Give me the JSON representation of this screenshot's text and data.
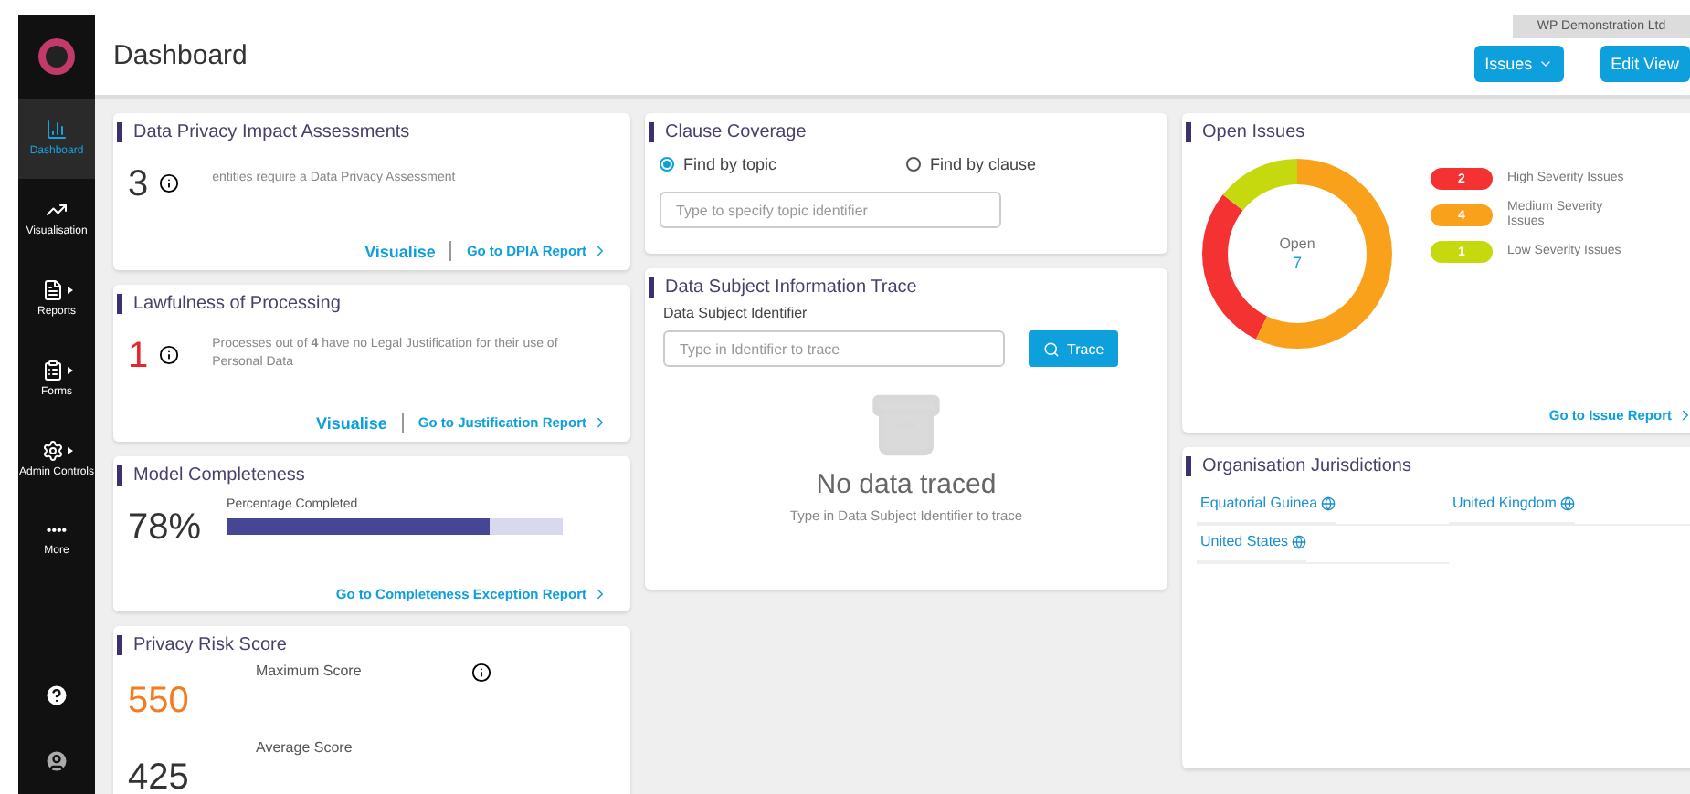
{
  "sidebar": {
    "items": [
      {
        "label": "Dashboard",
        "selected": true,
        "submenu": false
      },
      {
        "label": "Visualisation",
        "selected": false,
        "submenu": false
      },
      {
        "label": "Reports",
        "selected": false,
        "submenu": true
      },
      {
        "label": "Forms",
        "selected": false,
        "submenu": true
      },
      {
        "label": "Admin Controls",
        "selected": false,
        "submenu": true
      },
      {
        "label": "More",
        "selected": false,
        "submenu": false,
        "glyph": "••••"
      }
    ]
  },
  "header": {
    "title": "Dashboard",
    "organisation": "WP Demonstration Ltd",
    "buttons": [
      {
        "label": "Issues",
        "dropdown": true
      },
      {
        "label": "Edit View",
        "dropdown": false
      }
    ]
  },
  "dpia": {
    "title": "Data Privacy Impact Assessments",
    "count": "3",
    "text": "entities require a Data Privacy Assessment",
    "links": [
      "Visualise",
      "Go to DPIA Report"
    ]
  },
  "lawfulness": {
    "title": "Lawfulness of Processing",
    "count": "1",
    "text": "Processes out of **4** have no Legal Justification for their use of Personal Data",
    "links": [
      "Visualise",
      "Go to Justification Report"
    ]
  },
  "model_completeness": {
    "title": "Model Completeness",
    "percent": "78%",
    "bar_label": "Percentage Completed",
    "level": 0.78,
    "link": "Go to Completeness Exception Report"
  },
  "privacy_risk": {
    "title": "Privacy Risk Score",
    "scores": [
      {
        "value": "550",
        "label": "Maximum Score",
        "color": "#f47b20"
      },
      {
        "value": "425",
        "label": "Average Score",
        "color": "#333333"
      }
    ]
  },
  "clause_coverage": {
    "title": "Clause Coverage",
    "options": [
      {
        "label": "Find by topic",
        "selected": true
      },
      {
        "label": "Find by clause",
        "selected": false
      }
    ],
    "placeholder": "Type to specify topic identifier"
  },
  "trace": {
    "title": "Data Subject Information Trace",
    "field_label": "Data Subject Identifier",
    "placeholder": "Type in Identifier to trace",
    "button": "Trace",
    "empty_title": "No data traced",
    "empty_text": "Type in Data Subject Identifier to trace"
  },
  "open_issues": {
    "title": "Open Issues",
    "center_label": "Open",
    "center_value": "7",
    "legend": [
      {
        "count": "2",
        "label": "High Severity Issues",
        "color": "#f53232"
      },
      {
        "count": "4",
        "label": "Medium Severity Issues",
        "color": "#f9a11b"
      },
      {
        "count": "1",
        "label": "Low Severity Issues",
        "color": "#c6d90f"
      }
    ],
    "link": "Go to Issue Report"
  },
  "jurisdictions": {
    "title": "Organisation Jurisdictions",
    "items": [
      "Equatorial Guinea",
      "United Kingdom",
      "United States"
    ]
  }
}
